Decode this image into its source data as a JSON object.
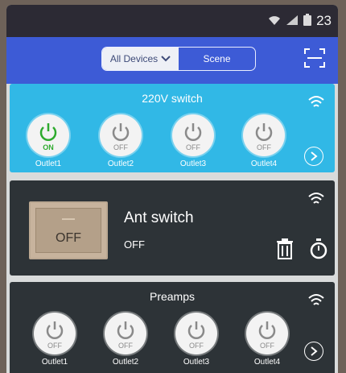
{
  "status_bar": {
    "time": "23",
    "icons": [
      "wifi-icon",
      "signal-icon",
      "battery-icon"
    ]
  },
  "app_bar": {
    "segments": [
      {
        "label": "All Devices",
        "active": true
      },
      {
        "label": "Scene",
        "active": false
      }
    ],
    "scan_icon": "scan-icon"
  },
  "devices": [
    {
      "name": "220V switch",
      "outlets": [
        {
          "label": "Outlet1",
          "state": "ON"
        },
        {
          "label": "Outlet2",
          "state": "OFF"
        },
        {
          "label": "Outlet3",
          "state": "OFF"
        },
        {
          "label": "Outlet4",
          "state": "OFF"
        }
      ]
    },
    {
      "name": "Ant switch",
      "state": "OFF",
      "switch_label": "OFF"
    },
    {
      "name": "Preamps",
      "outlets": [
        {
          "label": "Outlet1",
          "state": "OFF"
        },
        {
          "label": "Outlet2",
          "state": "OFF"
        },
        {
          "label": "Outlet3",
          "state": "OFF"
        },
        {
          "label": "Outlet4",
          "state": "OFF"
        }
      ]
    }
  ],
  "colors": {
    "app_bar": "#3d5bd6",
    "card_blue": "#31b8e6",
    "card_dark": "#2d3337",
    "on_green": "#2eaa2e"
  }
}
